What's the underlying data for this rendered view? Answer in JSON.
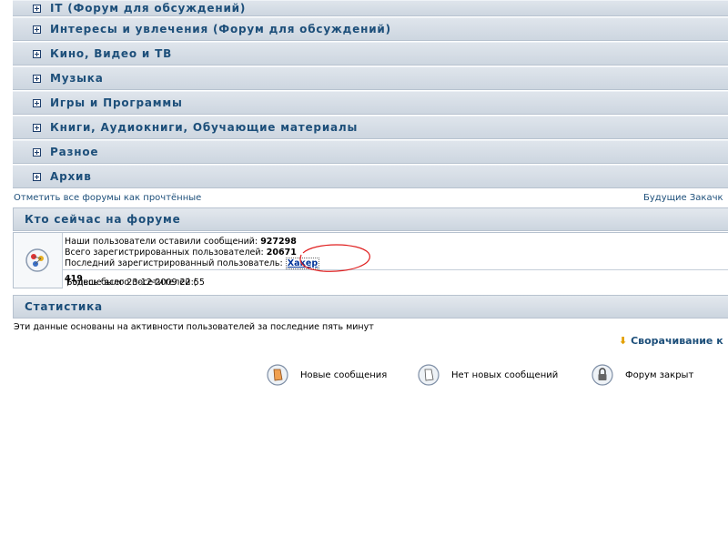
{
  "categories": [
    {
      "label": "IT (Форум для обсуждений)"
    },
    {
      "label": "Интересы и увлечения (Форум для обсуждений)"
    },
    {
      "label": "Кино, Видео и ТВ"
    },
    {
      "label": "Музыка"
    },
    {
      "label": "Игры и Программы"
    },
    {
      "label": "Книги, Аудиокниги, Обучающие материалы"
    },
    {
      "label": "Разное"
    },
    {
      "label": "Архив"
    }
  ],
  "links": {
    "mark_read": "Отметить все форумы как прочтённые",
    "future_downloads": "Будущие Закачк"
  },
  "online": {
    "title": "Кто сейчас на форуме",
    "posts_prefix": "Наши пользователи оставили сообщений: ",
    "posts_count": "927298",
    "users_prefix": "Всего зарегистрированных пользователей: ",
    "users_count": "20671",
    "newest_prefix": "Последний зарегистрированный пользователь: ",
    "newest_user": "Хакер",
    "max_prefix": "Больше всего посетителей (",
    "max_count": "419",
    "max_suffix": ") здесь было 23-12-2009 22:55"
  },
  "statistics": {
    "title": "Статистика"
  },
  "footer": {
    "based_on": "Эти данные основаны на активности пользователей за последние пять минут",
    "collapse": "Сворачивание к"
  },
  "legend": {
    "new_posts": "Новые сообщения",
    "no_new_posts": "Нет новых сообщений",
    "forum_locked": "Форум закрыт"
  },
  "colors": {
    "link": "#1d4f7a",
    "header_bg": "#d6dde6",
    "annotation": "#e02020"
  }
}
